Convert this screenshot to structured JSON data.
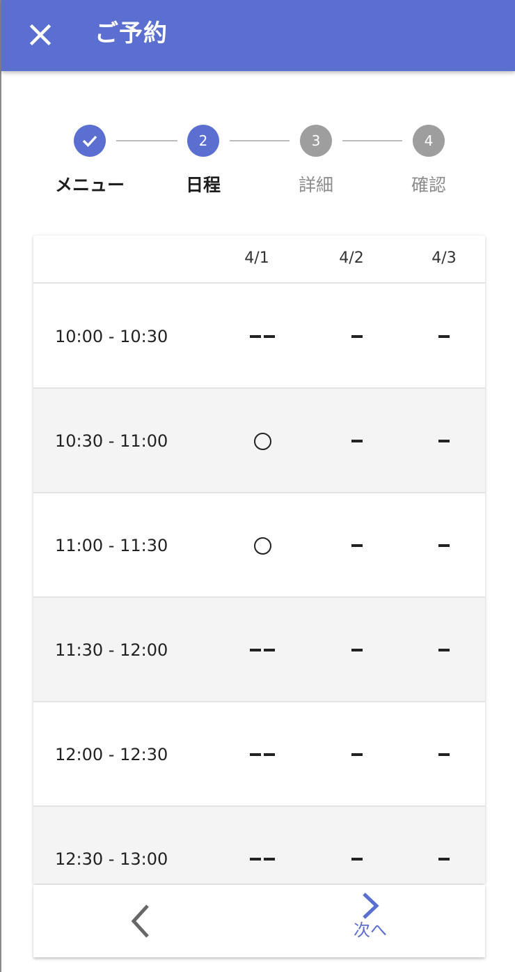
{
  "appbar": {
    "title": "ご予約",
    "close_icon": "close-icon",
    "color": "#5a6fd0"
  },
  "stepper": {
    "steps": [
      {
        "marker": "",
        "label": "メニュー",
        "state": "done"
      },
      {
        "marker": "2",
        "label": "日程",
        "state": "active"
      },
      {
        "marker": "3",
        "label": "詳細",
        "state": "pending"
      },
      {
        "marker": "4",
        "label": "確認",
        "state": "pending"
      }
    ]
  },
  "table": {
    "dates": [
      "4/1",
      "4/2",
      "4/3"
    ],
    "rows": [
      {
        "time": "10:00 - 10:30",
        "cells": [
          "--",
          "-",
          "-"
        ]
      },
      {
        "time": "10:30 - 11:00",
        "cells": [
          "○",
          "-",
          "-"
        ]
      },
      {
        "time": "11:00 - 11:30",
        "cells": [
          "○",
          "-",
          "-"
        ]
      },
      {
        "time": "11:30 - 12:00",
        "cells": [
          "--",
          "-",
          "-"
        ]
      },
      {
        "time": "12:00 - 12:30",
        "cells": [
          "--",
          "-",
          "-"
        ]
      },
      {
        "time": "12:30 - 13:00",
        "cells": [
          "--",
          "-",
          "-"
        ]
      }
    ]
  },
  "footer": {
    "prev_icon": "chevron-left-icon",
    "next_icon": "chevron-right-icon",
    "next_label": "次へ"
  }
}
